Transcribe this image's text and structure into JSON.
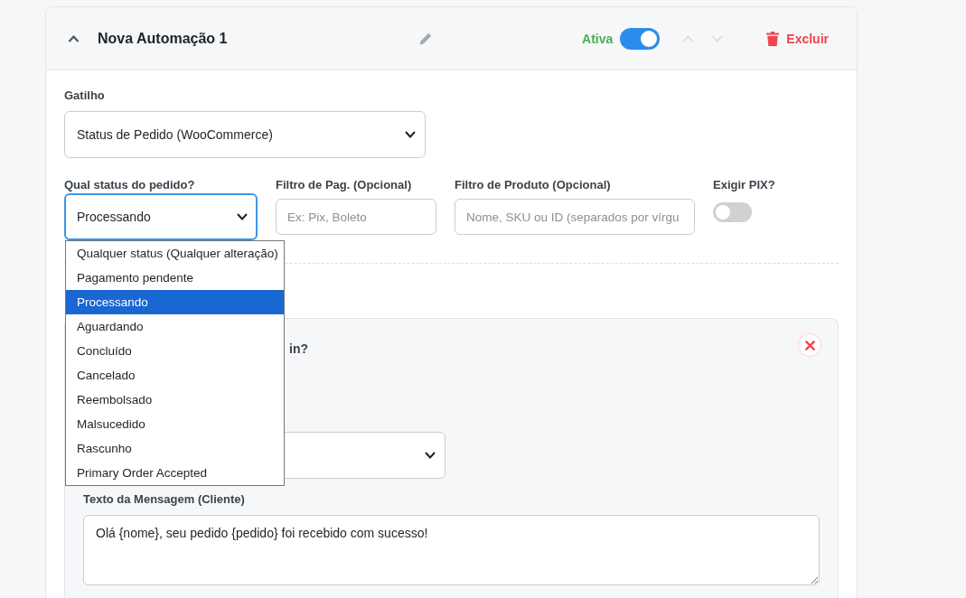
{
  "automation": {
    "title": "Nova Automação 1",
    "expanded": true,
    "active": true,
    "status_label": "Ativa",
    "move_buttons": [
      {
        "kind": "up",
        "disabled": true
      },
      {
        "kind": "down",
        "disabled": true
      }
    ],
    "delete_label": "Excluir"
  },
  "trigger": {
    "label": "Gatilho",
    "value": "Status de Pedido (WooCommerce)"
  },
  "conditions": [
    {
      "kind": "select",
      "label": "Qual status do pedido?",
      "value": "Processando",
      "focused": true,
      "open": true,
      "options": [
        {
          "label": "Qualquer status (Qualquer alteração)",
          "selected": false
        },
        {
          "label": "Pagamento pendente",
          "selected": false
        },
        {
          "label": "Processando",
          "selected": true
        },
        {
          "label": "Aguardando",
          "selected": false
        },
        {
          "label": "Concluído",
          "selected": false
        },
        {
          "label": "Cancelado",
          "selected": false
        },
        {
          "label": "Reembolsado",
          "selected": false
        },
        {
          "label": "Malsucedido",
          "selected": false
        },
        {
          "label": "Rascunho",
          "selected": false
        },
        {
          "label": "Primary Order Accepted",
          "selected": false
        }
      ]
    },
    {
      "kind": "input",
      "label": "Filtro de Pag. (Opcional)",
      "placeholder": "Ex: Pix, Boleto",
      "focused": false
    },
    {
      "kind": "input",
      "label": "Filtro de Produto (Opcional)",
      "placeholder": "Nome, SKU ou ID (separados por vírgu",
      "focused": false
    },
    {
      "kind": "toggle",
      "label": "Exigir PIX?",
      "on": false
    }
  ],
  "action": {
    "question": "in?",
    "message_label": "Texto da Mensagem (Cliente)",
    "message": "Olá {nome}, seu pedido {pedido} foi recebido com sucesso!"
  }
}
